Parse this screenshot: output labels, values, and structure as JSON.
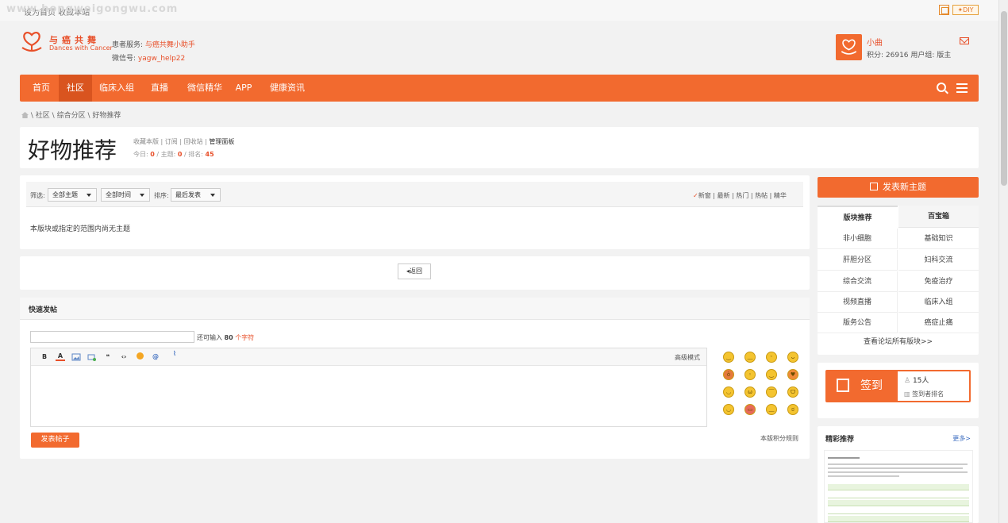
{
  "topbar": {
    "watermark": "www.hongweigongwu.com",
    "links": "设为首页 收藏本站",
    "diy": "✦DIY"
  },
  "header": {
    "logo_cn": "与癌共舞",
    "logo_en": "Dances with Cancer",
    "service_label": "患者服务:",
    "service_link": "与癌共舞小助手",
    "wechat_label": "微信号:",
    "wechat_id": "yagw_help22"
  },
  "user": {
    "name": "小曲",
    "meta": "积分: 26916  用户组: 版主"
  },
  "nav": {
    "items": [
      "首页",
      "社区",
      "临床入组",
      "直播",
      "微信精华",
      "APP",
      "健康资讯"
    ]
  },
  "breadcrumb": {
    "items": [
      "社区",
      "综合分区",
      "好物推荐"
    ]
  },
  "forum": {
    "title": "好物推荐",
    "links": [
      "收藏本版",
      "订阅",
      "回收站",
      "管理面板"
    ],
    "today_label": "今日:",
    "today": "0",
    "threads_label": "主题:",
    "threads": "0",
    "rank_label": "排名:",
    "rank": "45"
  },
  "filter": {
    "label": "筛选:",
    "type": "全部主题",
    "time": "全部时间",
    "sort_label": "排序:",
    "sort": "最后发表",
    "orders": [
      "新窗",
      "最新",
      "热门",
      "热帖",
      "精华"
    ]
  },
  "empty_msg": "本版块或指定的范围内尚无主题",
  "pager": {
    "back": "返回"
  },
  "quick_post": {
    "title": "快速发帖",
    "remain_pre": "还可输入",
    "remain_num": "80",
    "remain_unit": "个字符",
    "advanced": "高级模式",
    "submit": "发表帖子",
    "rules": "本版积分规则"
  },
  "sidebar": {
    "new_thread": "发表新主题",
    "tabs": [
      "版块推荐",
      "百宝箱"
    ],
    "boards": [
      [
        "非小细胞",
        "基础知识"
      ],
      [
        "肝胆分区",
        "妇科交流"
      ],
      [
        "综合交流",
        "免疫治疗"
      ],
      [
        "视频直播",
        "临床入组"
      ],
      [
        "版务公告",
        "癌症止痛"
      ]
    ],
    "all_boards": "查看论坛所有版块>>",
    "signin": {
      "label": "签到",
      "count": "15人",
      "rank": "签到者排名"
    },
    "featured": {
      "title": "精彩推荐",
      "more": "更多>"
    }
  }
}
